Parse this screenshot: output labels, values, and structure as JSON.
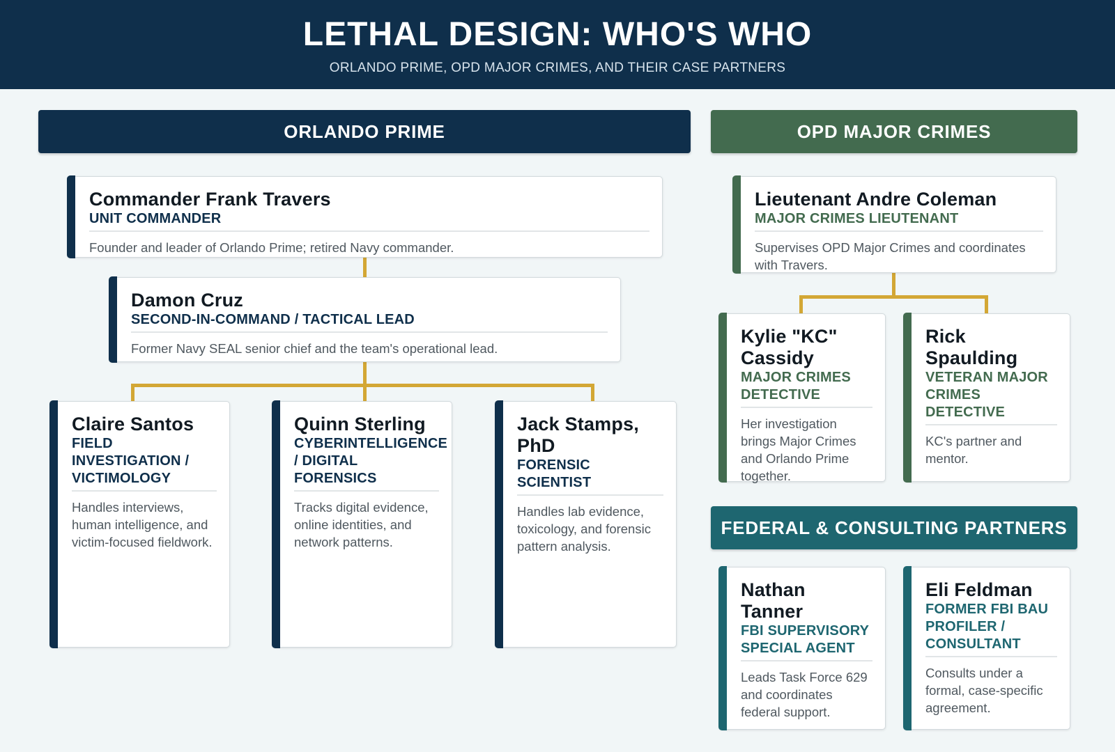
{
  "header": {
    "title": "LETHAL DESIGN: WHO'S WHO",
    "subtitle": "ORLANDO PRIME, OPD MAJOR CRIMES, AND THEIR CASE PARTNERS"
  },
  "sections": {
    "prime": "ORLANDO PRIME",
    "opd": "OPD MAJOR CRIMES",
    "federal": "FEDERAL & CONSULTING PARTNERS"
  },
  "colors": {
    "navy": "#0f2f4b",
    "green": "#436b4f",
    "teal": "#1e6670",
    "connector": "#d3a735"
  },
  "people": {
    "travers": {
      "name": "Commander Frank Travers",
      "role": "UNIT COMMANDER",
      "desc": "Founder and leader of Orlando Prime; retired Navy commander."
    },
    "cruz": {
      "name": "Damon Cruz",
      "role": "SECOND-IN-COMMAND / TACTICAL LEAD",
      "desc": "Former Navy SEAL senior chief and the team's operational lead."
    },
    "santos": {
      "name": "Claire Santos",
      "role": "FIELD INVESTIGATION / VICTIMOLOGY",
      "desc": "Handles interviews, human intelligence, and victim-focused fieldwork."
    },
    "sterling": {
      "name": "Quinn Sterling",
      "role": "CYBERINTELLIGENCE / DIGITAL FORENSICS",
      "desc": "Tracks digital evidence, online identities, and network patterns."
    },
    "stamps": {
      "name": "Jack Stamps, PhD",
      "role": "FORENSIC SCIENTIST",
      "desc": "Handles lab evidence, toxicology, and forensic pattern analysis."
    },
    "coleman": {
      "name": "Lieutenant Andre Coleman",
      "role": "MAJOR CRIMES LIEUTENANT",
      "desc": "Supervises OPD Major Crimes and coordinates with Travers."
    },
    "cassidy": {
      "name": "Kylie \"KC\" Cassidy",
      "role": "MAJOR CRIMES DETECTIVE",
      "desc": "Her investigation brings Major Crimes and Orlando Prime together."
    },
    "spaulding": {
      "name": "Rick Spaulding",
      "role": "VETERAN MAJOR CRIMES DETECTIVE",
      "desc": "KC's partner and mentor."
    },
    "tanner": {
      "name": "Nathan Tanner",
      "role": "FBI SUPERVISORY SPECIAL AGENT",
      "desc": "Leads Task Force 629 and coordinates federal support."
    },
    "feldman": {
      "name": "Eli Feldman",
      "role": "FORMER FBI BAU PROFILER / CONSULTANT",
      "desc": "Consults under a formal, case-specific agreement."
    }
  }
}
